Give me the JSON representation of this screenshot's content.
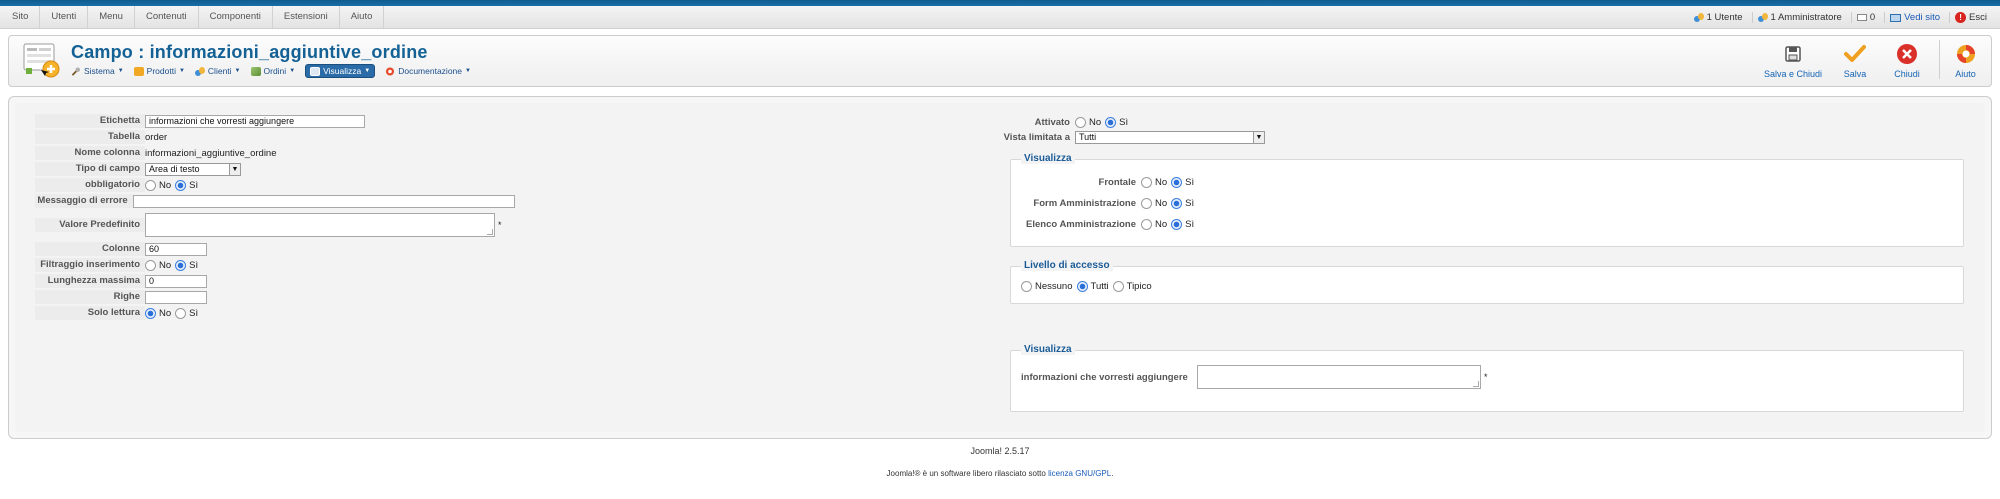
{
  "menubar": {
    "items": [
      "Sito",
      "Utenti",
      "Menu",
      "Contenuti",
      "Componenti",
      "Estensioni",
      "Aiuto"
    ],
    "status": {
      "users": "1 Utente",
      "admins": "1 Amministratore",
      "messages": "0",
      "view_site": "Vedi sito",
      "logout": "Esci"
    }
  },
  "header": {
    "title": "Campo : informazioni_aggiuntive_ordine",
    "submenu": [
      "Sistema",
      "Prodotti",
      "Clienti",
      "Ordini",
      "Visualizza",
      "Documentazione"
    ],
    "active_submenu": "Visualizza"
  },
  "toolbar": {
    "save_close": "Salva e Chiudi",
    "save": "Salva",
    "close": "Chiudi",
    "help": "Aiuto"
  },
  "form": {
    "etichetta": {
      "label": "Etichetta",
      "value": "informazioni che vorresti aggiungere"
    },
    "tabella": {
      "label": "Tabella",
      "value": "order"
    },
    "nome_colonna": {
      "label": "Nome colonna",
      "value": "informazioni_aggiuntive_ordine"
    },
    "tipo_campo": {
      "label": "Tipo di campo",
      "value": "Area di testo"
    },
    "obbligatorio": {
      "label": "obbligatorio",
      "no": "No",
      "si": "Sì",
      "selected": "si"
    },
    "messaggio_errore": {
      "label": "Messaggio di errore",
      "value": ""
    },
    "valore_predefinito": {
      "label": "Valore Predefinito",
      "value": "",
      "required_mark": "*"
    },
    "colonne": {
      "label": "Colonne",
      "value": "60"
    },
    "filtraggio": {
      "label": "Filtraggio inserimento",
      "no": "No",
      "si": "Sì",
      "selected": "si"
    },
    "lunghezza": {
      "label": "Lunghezza massima",
      "value": "0"
    },
    "righe": {
      "label": "Righe",
      "value": ""
    },
    "solo_lettura": {
      "label": "Solo lettura",
      "no": "No",
      "si": "Sì",
      "selected": "no"
    }
  },
  "right": {
    "attivato": {
      "label": "Attivato",
      "no": "No",
      "si": "Sì",
      "selected": "si"
    },
    "vista": {
      "label": "Vista limitata a",
      "value": "Tutti"
    },
    "visualizza1": {
      "legend": "Visualizza",
      "frontale": {
        "label": "Frontale",
        "no": "No",
        "si": "Sì",
        "selected": "si"
      },
      "form_admin": {
        "label": "Form Amministrazione",
        "no": "No",
        "si": "Sì",
        "selected": "si"
      },
      "elenco_admin": {
        "label": "Elenco Amministrazione",
        "no": "No",
        "si": "Sì",
        "selected": "si"
      }
    },
    "livello": {
      "legend": "Livello di accesso",
      "nessuno": "Nessuno",
      "tutti": "Tutti",
      "tipico": "Tipico",
      "selected": "tutti"
    },
    "visualizza2": {
      "legend": "Visualizza",
      "label": "informazioni che vorresti aggiungere",
      "required_mark": "*"
    }
  },
  "footer": {
    "version": "Joomla! 2.5.17",
    "license_prefix": "Joomla!® è un software libero rilasciato sotto ",
    "license_link": "licenza GNU/GPL",
    "license_suffix": "."
  }
}
